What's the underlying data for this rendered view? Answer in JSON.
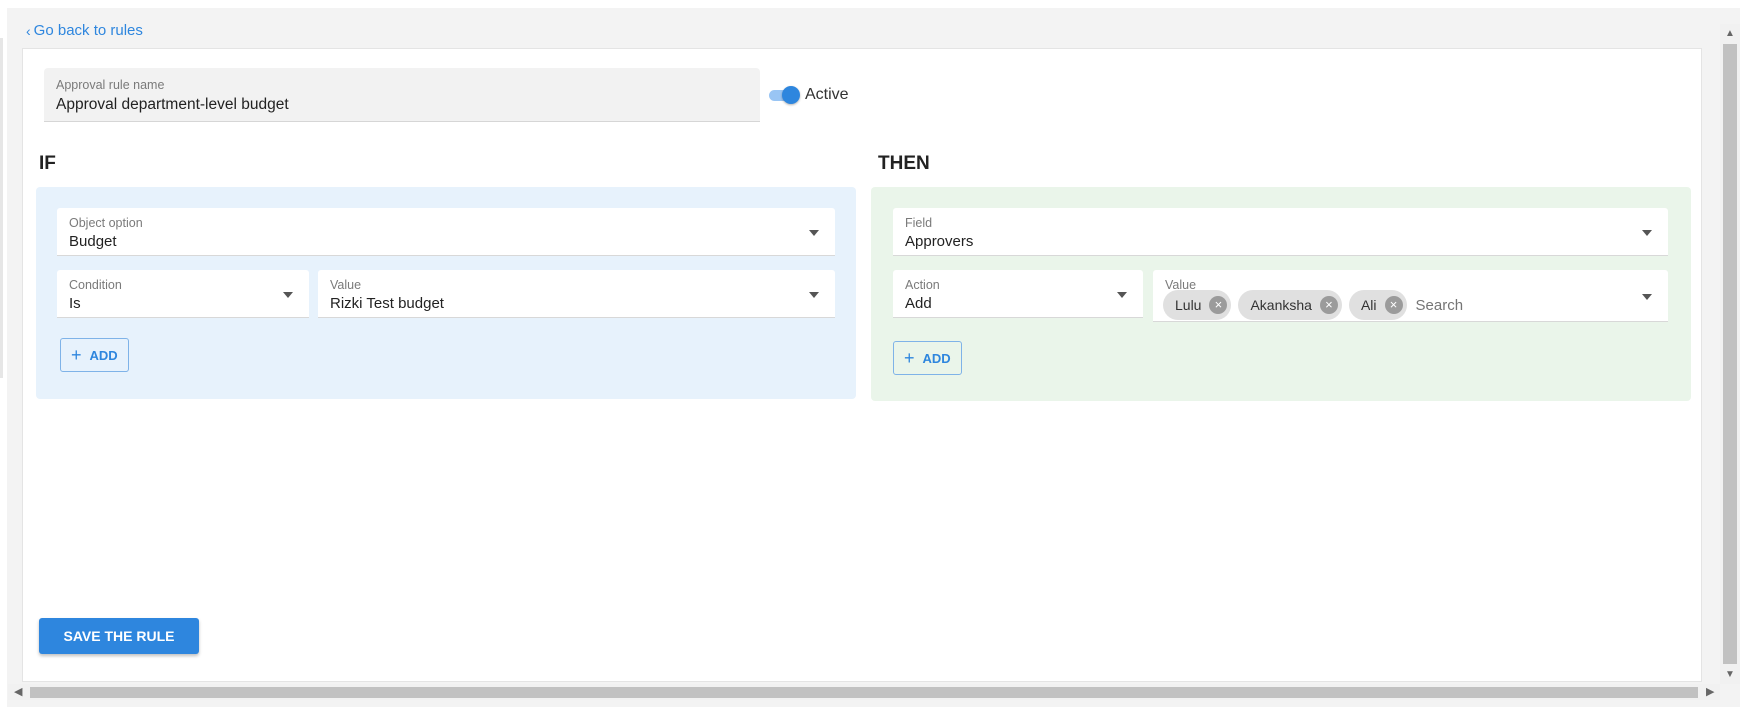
{
  "nav": {
    "back_label": "Go back to rules"
  },
  "rule": {
    "name_label": "Approval rule name",
    "name_value": "Approval department-level budget",
    "active_label": "Active",
    "active": true
  },
  "if_section": {
    "title": "IF",
    "object_option": {
      "label": "Object option",
      "value": "Budget"
    },
    "condition": {
      "label": "Condition",
      "value": "Is"
    },
    "value": {
      "label": "Value",
      "value": "Rizki Test budget"
    },
    "add_label": "ADD"
  },
  "then_section": {
    "title": "THEN",
    "field": {
      "label": "Field",
      "value": "Approvers"
    },
    "action": {
      "label": "Action",
      "value": "Add"
    },
    "value": {
      "label": "Value",
      "chips": [
        "Lulu",
        "Akanksha",
        "Ali"
      ],
      "search_placeholder": "Search"
    },
    "add_label": "ADD"
  },
  "save_label": "SAVE THE RULE",
  "colors": {
    "accent": "#2e86de",
    "if_panel": "#e7f2fc",
    "then_panel": "#eaf5ea"
  },
  "icons": {
    "back": "chevron-left-icon",
    "dropdown": "caret-down-icon",
    "add": "plus-icon",
    "chip_remove": "close-circle-icon"
  }
}
